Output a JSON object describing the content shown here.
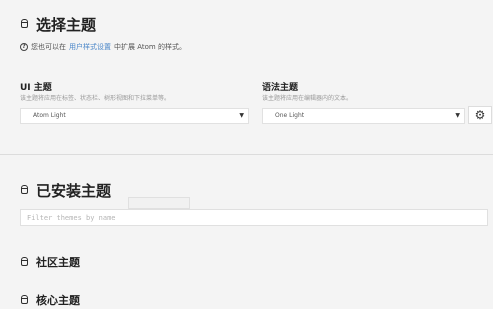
{
  "choose_theme": {
    "title": "选择主题",
    "info_prefix": "您也可以在",
    "info_link": "用户样式设置",
    "info_suffix": "中扩展 Atom 的样式。"
  },
  "ui_theme": {
    "label": "UI 主题",
    "description": "该主题将应用在标签、状态栏、树形视图和下拉菜单等。",
    "selected": "Atom Light"
  },
  "syntax_theme": {
    "label": "语法主题",
    "description": "该主题将应用在编辑器内的文本。",
    "selected": "One Light"
  },
  "installed": {
    "title": "已安装主题",
    "filter_placeholder": "Filter themes by name"
  },
  "community": {
    "title": "社区主题"
  },
  "core": {
    "title": "核心主题"
  },
  "icons": {
    "package": "package-icon",
    "question": "question-icon",
    "gear": "gear-icon",
    "dropdown": "dropdown-arrow-icon"
  }
}
